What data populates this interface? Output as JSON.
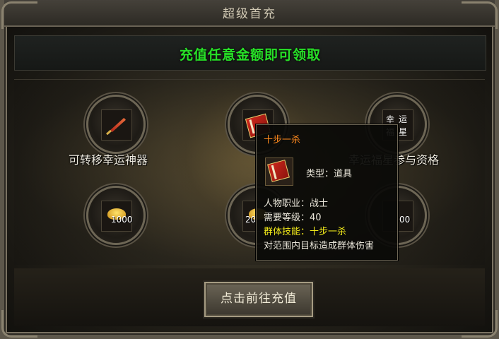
{
  "window": {
    "title": "超级首充",
    "close_icon": "close-icon"
  },
  "banner": {
    "text": "充值任意金额即可领取"
  },
  "rewards": [
    {
      "label": "可转移幸运神器",
      "icon": "sword-icon"
    },
    {
      "label": "",
      "icon": "book-icon"
    },
    {
      "label": "幸运福星参与资格",
      "icon": "lucky-star-icon",
      "icon_chars": [
        "幸",
        "运",
        "福",
        "星"
      ]
    },
    {
      "qty": "1000",
      "icon": "gold-ingot-icon"
    },
    {
      "qty": "20",
      "icon": "gold-ingot-icon"
    },
    {
      "qty": "00",
      "icon": "jade-icon"
    }
  ],
  "tooltip": {
    "name": "十步一杀",
    "type": "类型：道具",
    "job": "人物职业：战士",
    "level": "需要等级：40",
    "skill": "群体技能：十步一杀",
    "desc": "对范围内目标造成群体伤害"
  },
  "button": {
    "label": "点击前往充值"
  },
  "colors": {
    "banner": "#27e027",
    "item_name": "#ff8a1e",
    "skill": "#f2ea1a"
  }
}
